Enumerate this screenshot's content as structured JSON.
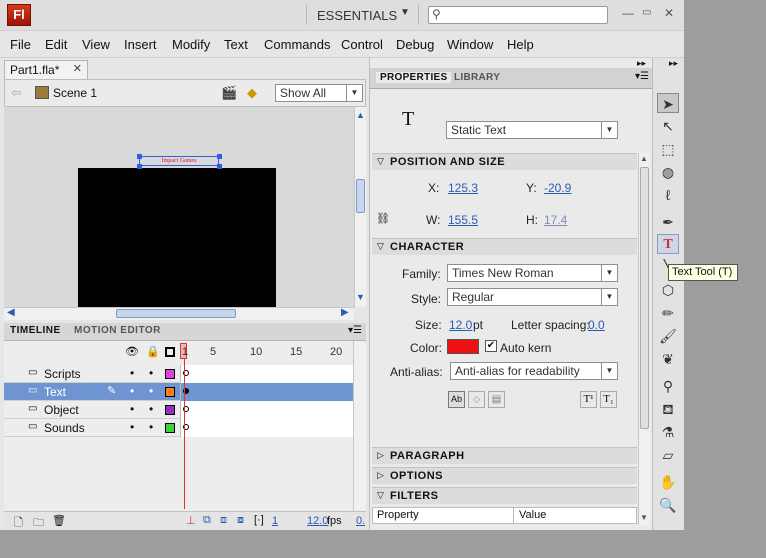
{
  "app": {
    "logo": "Fl",
    "workspace": "ESSENTIALS",
    "search_placeholder": ""
  },
  "menu": [
    "File",
    "Edit",
    "View",
    "Insert",
    "Modify",
    "Text",
    "Commands",
    "Control",
    "Debug",
    "Window",
    "Help"
  ],
  "document": {
    "tab": "Part1.fla*",
    "scene": "Scene 1",
    "zoom": "Show All",
    "text_on_stage": "Impact Games"
  },
  "timeline": {
    "tabs": [
      "TIMELINE",
      "MOTION EDITOR"
    ],
    "frame_numbers": [
      "1",
      "5",
      "10",
      "15",
      "20"
    ],
    "layers": [
      {
        "name": "Scripts",
        "color": "#e040e0",
        "selected": false
      },
      {
        "name": "Text",
        "color": "#f08020",
        "selected": true
      },
      {
        "name": "Object",
        "color": "#9030c0",
        "selected": false
      },
      {
        "name": "Sounds",
        "color": "#40d040",
        "selected": false
      }
    ],
    "current_frame": "1",
    "fps": "12.0",
    "fps_unit": "fps",
    "elapsed": "0."
  },
  "properties": {
    "tabs": [
      "PROPERTIES",
      "LIBRARY"
    ],
    "text_type": "Static Text",
    "position": {
      "title": "POSITION AND SIZE",
      "x_label": "X:",
      "x": "125.3",
      "y_label": "Y:",
      "y": "-20.9",
      "w_label": "W:",
      "w": "155.5",
      "h_label": "H:",
      "h": "17.4"
    },
    "character": {
      "title": "CHARACTER",
      "family_label": "Family:",
      "family": "Times New Roman",
      "style_label": "Style:",
      "style": "Regular",
      "size_label": "Size:",
      "size": "12.0",
      "size_unit": "pt",
      "spacing_label": "Letter spacing:",
      "spacing": "0.0",
      "color_label": "Color:",
      "color": "#ee1111",
      "autokern": "Auto kern",
      "antialias_label": "Anti-alias:",
      "antialias": "Anti-alias for readability"
    },
    "collapsed_sections": [
      "PARAGRAPH",
      "OPTIONS"
    ],
    "filters": {
      "title": "FILTERS",
      "col_property": "Property",
      "col_value": "Value"
    }
  },
  "tooltip": "Text Tool (T)"
}
